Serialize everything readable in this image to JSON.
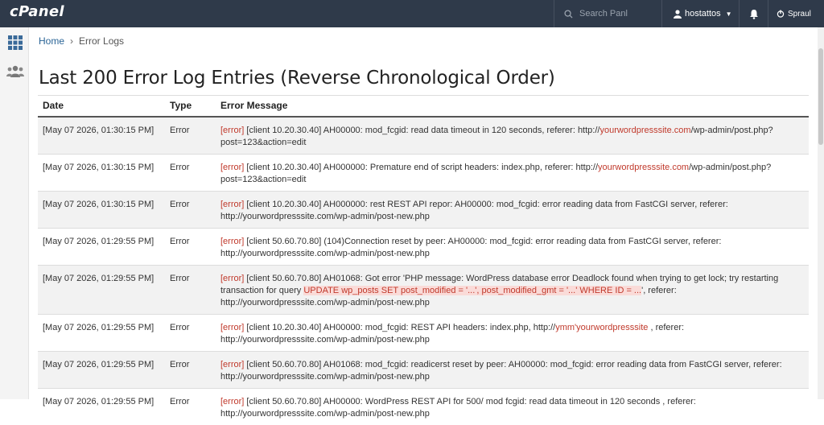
{
  "header": {
    "logo": "cPanel",
    "search_placeholder": "Search Panl",
    "username": "hostattos",
    "logout_label": "Spraul"
  },
  "breadcrumb": {
    "home": "Home",
    "current": "Error Logs"
  },
  "page_title": "Last 200 Error Log Entries (Reverse Chronological Order)",
  "table": {
    "headers": {
      "date": "Date",
      "type": "Type",
      "message": "Error Message"
    },
    "rows": [
      {
        "date": "[May 07 2026, 01:30:15 PM]",
        "type": "Error",
        "tag": "[error]",
        "pre": " [client 10.20.30.40] AH00000: mod_fcgid: read data timeout in 120 seconds, referer: http://",
        "site": "yourwordpresssite.com",
        "post": "/wp-admin/post.php?post=123&action=edit"
      },
      {
        "date": "[May 07 2026, 01:30:15 PM]",
        "type": "Error",
        "tag": "[error]",
        "pre": " [client 10.20.30.40] AH000000: Premature end of script headers: index.php, referer: http://",
        "site": "yourwordpresssite.com",
        "post": "/wp-admin/post.php?post=123&action=edit"
      },
      {
        "date": "[May 07 2026, 01:30:15 PM]",
        "type": "Error",
        "tag": "[error]",
        "pre": " [client 10.20.30.40] AH000000: rest REST API repor: AH00000: mod_fcgid: error reading data from FastCGI server, referer: http://yourwordpresssite.com/wp-admin/post-new.php",
        "site": "",
        "post": ""
      },
      {
        "date": "[May 07 2026, 01:29:55 PM]",
        "type": "Error",
        "tag": "[error]",
        "pre": " [client 50.60.70.80] (104)Connection reset by peer: AH00000: mod_fcgid: error reading data from FastCGI server, referer: http://yourwordpresssite.com/wp-admin/post-new.php",
        "site": "",
        "post": ""
      },
      {
        "date": "[May 07 2026, 01:29:55 PM]",
        "type": "Error",
        "tag": "[error]",
        "pre": " [client 50.60.70.80] AH01068: Got error 'PHP message: WordPress database error Deadlock found when trying to get lock; try restarting transaction for query ",
        "highlight": "UPDATE wp_posts SET post_modified = '...', post_modified_gmt = '...' WHERE ID = ...",
        "post": "', referer: http://yourwordpresssite.com/wp-admin/post-new.php"
      },
      {
        "date": "[May 07 2026, 01:29:55 PM]",
        "type": "Error",
        "tag": "[error]",
        "pre": " [client 10.20.30.40] AH00000: mod_fcgid: REST API headers: index.php, http://",
        "site": "ymm'yourwordpresssite",
        "post": " , referer: http://yourwordpresssite.com/wp-admin/post-new.php"
      },
      {
        "date": "[May 07 2026, 01:29:55 PM]",
        "type": "Error",
        "tag": "[error]",
        "pre": " [client 50.60.70.80] AH01068: mod_fcgid: readicerst reset by peer: AH00000: mod_fcgid: error reading data from FastCGI server, referer: http://yourwordpresssite.com/wp-admin/post-new.php",
        "site": "",
        "post": ""
      },
      {
        "date": "[May 07 2026, 01:29:55 PM]",
        "type": "Error",
        "tag": "[error]",
        "pre": " [client 50.60.70.80] AH00000: WordPress REST API for 500/ mod fcgid: read data timeout in 120 seconds , referer: http://yourwordpresssite.com/wp-admin/post-new.php",
        "site": "",
        "post": ""
      }
    ]
  },
  "colors": {
    "topbar": "#2f3a4a",
    "error": "#c0392b",
    "link": "#2a6496"
  }
}
